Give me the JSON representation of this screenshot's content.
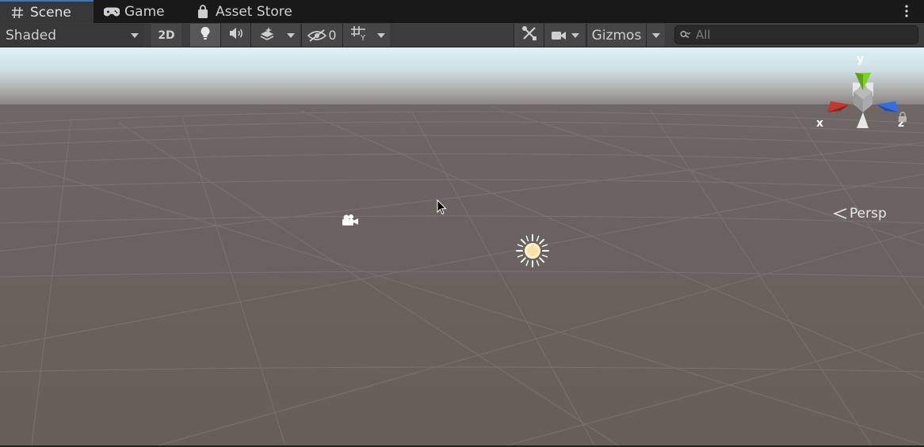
{
  "tabs": [
    {
      "label": "Scene",
      "icon": "grid-hash-icon",
      "active": true
    },
    {
      "label": "Game",
      "icon": "gamepad-icon",
      "active": false
    },
    {
      "label": "Asset Store",
      "icon": "shopping-bag-icon",
      "active": false
    }
  ],
  "toolbar": {
    "shading_mode": "Shaded",
    "mode_2d": "2D",
    "hidden_count": "0",
    "gizmos": "Gizmos",
    "search_placeholder": "All"
  },
  "viewport": {
    "projection": "Persp",
    "axes": {
      "x": "x",
      "y": "y",
      "z": "z"
    }
  },
  "colors": {
    "accent": "#3a79bb",
    "axis_x": "#c0392b",
    "axis_y": "#7ed321",
    "axis_z": "#2f6fe0",
    "ground": "#6b625e",
    "sky": "#dff1f6"
  }
}
